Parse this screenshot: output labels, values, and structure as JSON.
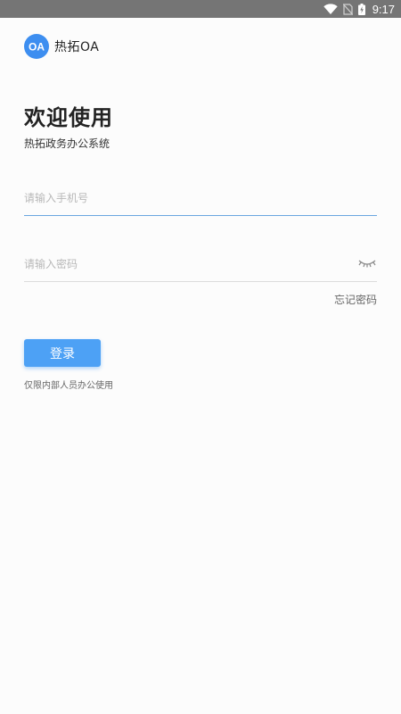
{
  "status_bar": {
    "time": "9:17",
    "icons": [
      "wifi-icon",
      "no-sim-icon",
      "battery-charging-icon"
    ]
  },
  "brand": {
    "logo_icon": "oa-logo-icon",
    "logo_text": "OA",
    "name": "热拓OA",
    "accent_color": "#3d8ef0"
  },
  "welcome": {
    "title": "欢迎使用",
    "subtitle": "热拓政务办公系统"
  },
  "form": {
    "phone": {
      "placeholder": "请输入手机号",
      "value": ""
    },
    "password": {
      "placeholder": "请输入密码",
      "value": "",
      "toggle_icon": "eye-closed-icon"
    },
    "forgot_label": "忘记密码",
    "login_label": "登录",
    "login_color": "#4da1f5",
    "note": "仅限内部人员办公使用"
  }
}
